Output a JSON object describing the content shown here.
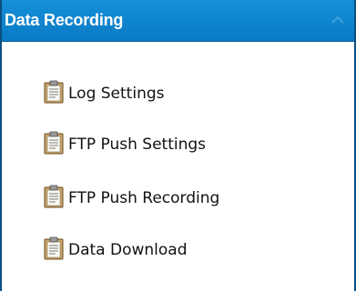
{
  "panel": {
    "title": "Data Recording",
    "collapse_icon": "chevron-up-icon",
    "colors": {
      "header": "#0a7ac5",
      "header_text": "#ffffff",
      "border": "#0a4f80"
    }
  },
  "menu": {
    "items": [
      {
        "label": "Log Settings",
        "icon": "clipboard-icon"
      },
      {
        "label": "FTP Push Settings",
        "icon": "clipboard-icon"
      },
      {
        "label": "FTP Push Recording",
        "icon": "clipboard-icon"
      },
      {
        "label": "Data Download",
        "icon": "clipboard-icon"
      }
    ]
  }
}
